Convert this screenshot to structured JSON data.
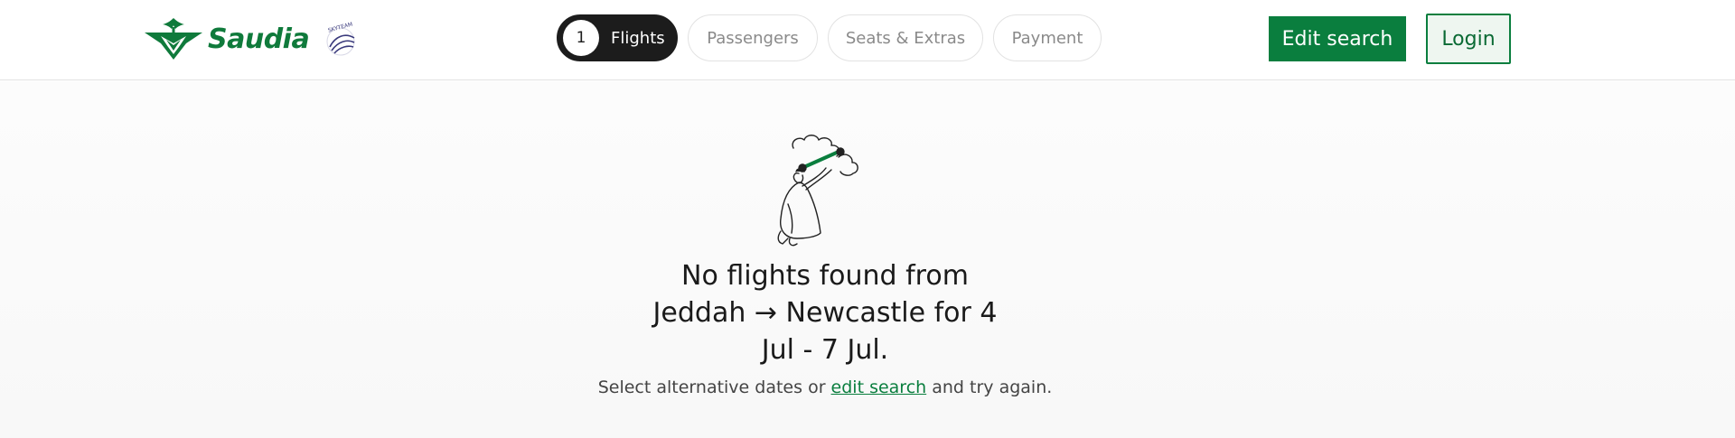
{
  "brand": {
    "name": "Saudia",
    "accent_color": "#0a7e3e",
    "partner_logo_text": "SKYTEAM"
  },
  "steps": [
    {
      "number": "1",
      "label": "Flights",
      "state": "active"
    },
    {
      "label": "Passengers",
      "state": "inactive"
    },
    {
      "label": "Seats & Extras",
      "state": "inactive"
    },
    {
      "label": "Payment",
      "state": "inactive"
    }
  ],
  "header": {
    "edit_search_label": "Edit search",
    "login_label": "Login"
  },
  "empty_state": {
    "illustration": "person-with-binoculars-in-clouds",
    "headline_line1": "No flights found from",
    "headline_line2": "Jeddah → Newcastle for 4",
    "headline_line3": "Jul - 7 Jul.",
    "sub_before": "Select alternative dates or",
    "sub_link": "edit search",
    "sub_after": "and try again."
  }
}
